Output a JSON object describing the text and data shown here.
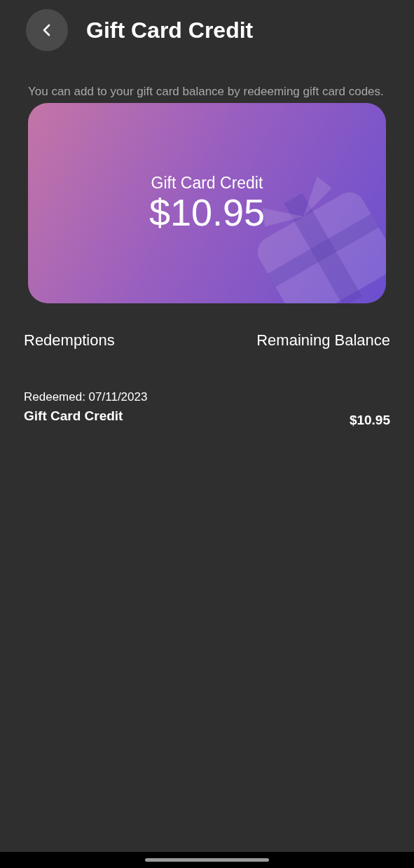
{
  "header": {
    "title": "Gift Card Credit"
  },
  "description": "You can add to your gift card balance by redeeming gift card codes.",
  "card": {
    "label": "Gift Card Credit",
    "amount": "$10.95"
  },
  "columns": [
    "Redemptions",
    "Remaining Balance"
  ],
  "redemptions": [
    {
      "date": "Redeemed: 07/11/2023",
      "name": "Gift Card Credit",
      "balance": "$10.95"
    }
  ]
}
